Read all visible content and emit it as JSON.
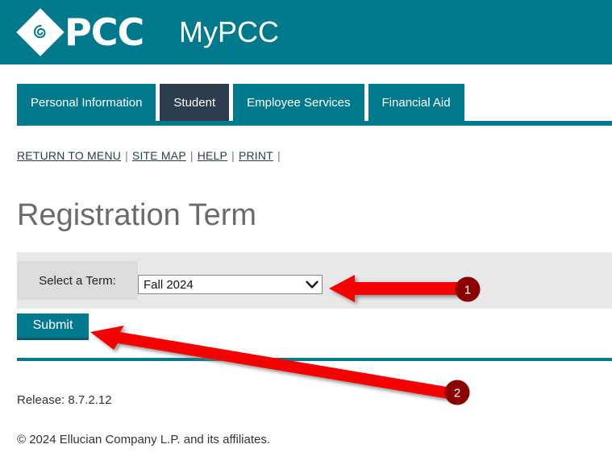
{
  "header": {
    "brand_primary": "PCC",
    "brand_secondary": "MyPCC",
    "logo_icon": "pcc-diamond-spiral-logo",
    "background_color": "#00798c"
  },
  "tabs": [
    {
      "label": "Personal Information",
      "active": false
    },
    {
      "label": "Student",
      "active": true
    },
    {
      "label": "Employee Services",
      "active": false
    },
    {
      "label": "Financial Aid",
      "active": false
    }
  ],
  "util_nav": {
    "items": [
      {
        "label": "RETURN TO MENU"
      },
      {
        "label": "SITE MAP"
      },
      {
        "label": "HELP"
      },
      {
        "label": "PRINT"
      }
    ],
    "separator": "|"
  },
  "page": {
    "title": "Registration Term"
  },
  "form": {
    "term_label": "Select a Term:",
    "term_selected": "Fall 2024",
    "term_options": [
      "Fall 2024"
    ],
    "chevron_icon": "chevron-down-icon",
    "submit_label": "Submit",
    "submit_color": "#00798c"
  },
  "footer": {
    "release": "Release: 8.7.2.12",
    "copyright": "© 2024 Ellucian Company L.P. and its affiliates."
  },
  "annotations": {
    "color": "#f40000",
    "badge_color": "#8b0000",
    "markers": [
      {
        "number": "1",
        "target": "term-select-dropdown"
      },
      {
        "number": "2",
        "target": "submit-button"
      }
    ]
  }
}
